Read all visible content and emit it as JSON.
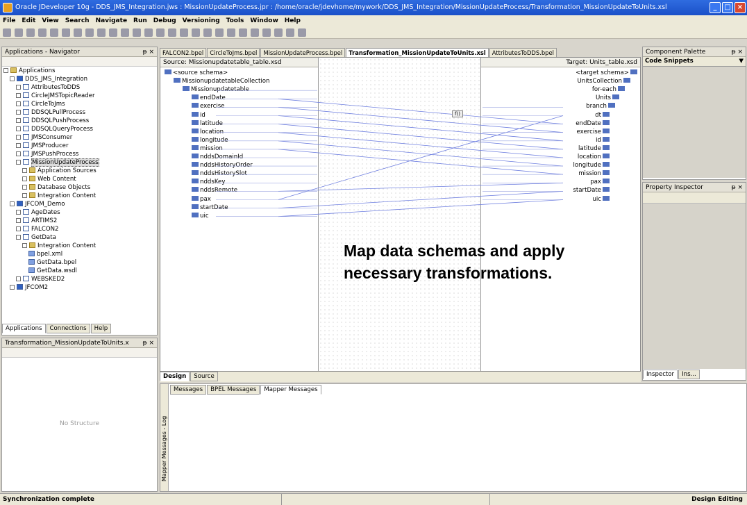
{
  "window": {
    "title": "Oracle JDeveloper 10g - DDS_JMS_Integration.jws : MissionUpdateProcess.jpr : /home/oracle/jdevhome/mywork/DDS_JMS_Integration/MissionUpdateProcess/Transformation_MissionUpdateToUnits.xsl"
  },
  "menu": [
    "File",
    "Edit",
    "View",
    "Search",
    "Navigate",
    "Run",
    "Debug",
    "Versioning",
    "Tools",
    "Window",
    "Help"
  ],
  "navigator": {
    "title": "Applications - Navigator",
    "tree": [
      {
        "label": "Applications",
        "level": 0,
        "icon": "fold"
      },
      {
        "label": "DDS_JMS_Integration",
        "level": 1,
        "icon": "proj"
      },
      {
        "label": "AttributesToDDS",
        "level": 2,
        "icon": "box"
      },
      {
        "label": "CircleJMSTopicReader",
        "level": 2,
        "icon": "box"
      },
      {
        "label": "CircleToJms",
        "level": 2,
        "icon": "box"
      },
      {
        "label": "DDSQLPullProcess",
        "level": 2,
        "icon": "box"
      },
      {
        "label": "DDSQLPushProcess",
        "level": 2,
        "icon": "box"
      },
      {
        "label": "DDSQLQueryProcess",
        "level": 2,
        "icon": "box"
      },
      {
        "label": "JMSConsumer",
        "level": 2,
        "icon": "box"
      },
      {
        "label": "JMSProducer",
        "level": 2,
        "icon": "box"
      },
      {
        "label": "JMSPushProcess",
        "level": 2,
        "icon": "box"
      },
      {
        "label": "MissionUpdateProcess",
        "level": 2,
        "icon": "box",
        "selected": true
      },
      {
        "label": "Application Sources",
        "level": 3,
        "icon": "fold"
      },
      {
        "label": "Web Content",
        "level": 3,
        "icon": "fold"
      },
      {
        "label": "Database Objects",
        "level": 3,
        "icon": "fold"
      },
      {
        "label": "Integration Content",
        "level": 3,
        "icon": "fold"
      },
      {
        "label": "JFCOM_Demo",
        "level": 1,
        "icon": "proj"
      },
      {
        "label": "AgeDates",
        "level": 2,
        "icon": "box"
      },
      {
        "label": "ARTIMS2",
        "level": 2,
        "icon": "box"
      },
      {
        "label": "FALCON2",
        "level": 2,
        "icon": "box"
      },
      {
        "label": "GetData",
        "level": 2,
        "icon": "box"
      },
      {
        "label": "Integration Content",
        "level": 3,
        "icon": "fold"
      },
      {
        "label": "bpel.xml",
        "level": 4,
        "icon": "file"
      },
      {
        "label": "GetData.bpel",
        "level": 4,
        "icon": "file"
      },
      {
        "label": "GetData.wsdl",
        "level": 4,
        "icon": "file"
      },
      {
        "label": "WEBSKED2",
        "level": 2,
        "icon": "box"
      },
      {
        "label": "JFCOM2",
        "level": 1,
        "icon": "proj"
      }
    ],
    "tabs": [
      "Applications",
      "Connections",
      "Help"
    ]
  },
  "structure": {
    "title": "Transformation_MissionUpdateToUnits.x",
    "empty_text": "No Structure"
  },
  "editor": {
    "tabs": [
      "FALCON2.bpel",
      "CircleToJms.bpel",
      "MissionUpdateProcess.bpel",
      "Transformation_MissionUpdateToUnits.xsl",
      "AttributesToDDS.bpel"
    ],
    "source_header": "Source: Missionupdatetable_table.xsd",
    "target_header": "Target: Units_table.xsd",
    "source_tree": [
      "<source schema>",
      "MissionupdatetableCollection",
      "Missionupdatetable",
      "endDate",
      "exercise",
      "id",
      "latitude",
      "location",
      "longitude",
      "mission",
      "nddsDomainId",
      "nddsHistoryOrder",
      "nddsHistorySlot",
      "nddsKey",
      "nddsRemote",
      "pax",
      "startDate",
      "uic"
    ],
    "target_tree": [
      "<target schema>",
      "UnitsCollection",
      "for-each",
      "Units",
      "branch",
      "dt",
      "endDate",
      "exercise",
      "id",
      "latitude",
      "location",
      "longitude",
      "mission",
      "pax",
      "startDate",
      "uic"
    ],
    "function_label": "f()",
    "overlay_text": "Map data schemas and apply necessary transformations.",
    "bottom_tabs": [
      "Design",
      "Source"
    ]
  },
  "log": {
    "side_label": "Mapper Messages - Log",
    "tabs": [
      "Messages",
      "BPEL Messages",
      "Mapper Messages"
    ]
  },
  "palette": {
    "title": "Component Palette",
    "dropdown": "Code Snippets"
  },
  "inspector": {
    "title": "Property Inspector",
    "tabs": [
      "Inspector",
      "Ins..."
    ]
  },
  "status": {
    "left": "Synchronization complete",
    "right": "Design Editing"
  }
}
